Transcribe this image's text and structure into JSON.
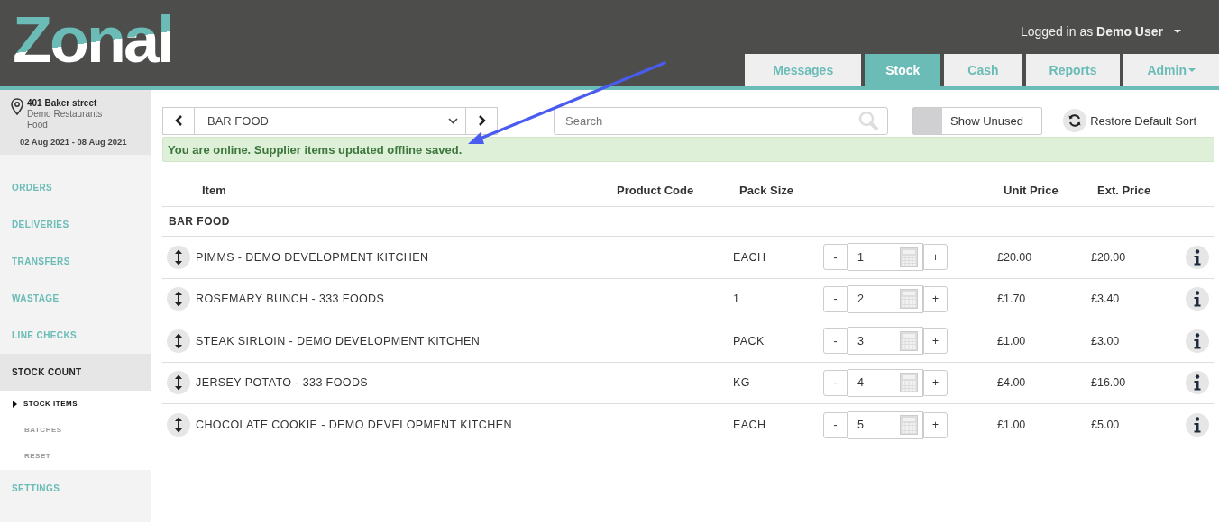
{
  "header": {
    "logo": "Zonal",
    "user_prefix": "Logged in as",
    "user_name": "Demo User"
  },
  "tabs": [
    {
      "label": "Messages",
      "selected": false,
      "dropdown": false
    },
    {
      "label": "Stock",
      "selected": true,
      "dropdown": false
    },
    {
      "label": "Cash",
      "selected": false,
      "dropdown": false
    },
    {
      "label": "Reports",
      "selected": false,
      "dropdown": false
    },
    {
      "label": "Admin",
      "selected": false,
      "dropdown": true
    }
  ],
  "location": {
    "name": "401 Baker street",
    "company": "Demo Restaurants",
    "area": "Food",
    "dates": "02 Aug 2021 - 08 Aug 2021"
  },
  "sidebar": {
    "items": [
      {
        "label": "ORDERS",
        "selected": false
      },
      {
        "label": "DELIVERIES",
        "selected": false
      },
      {
        "label": "TRANSFERS",
        "selected": false
      },
      {
        "label": "WASTAGE",
        "selected": false
      },
      {
        "label": "LINE CHECKS",
        "selected": false
      },
      {
        "label": "STOCK COUNT",
        "selected": true,
        "children": [
          {
            "label": "STOCK ITEMS",
            "selected": true
          },
          {
            "label": "BATCHES",
            "selected": false
          },
          {
            "label": "RESET",
            "selected": false
          }
        ]
      },
      {
        "label": "SETTINGS",
        "selected": false
      }
    ]
  },
  "toolbar": {
    "category": "BAR FOOD",
    "search": {
      "placeholder": "Search"
    },
    "show_unused": {
      "label": "Show Unused",
      "on": false
    },
    "restore": "Restore Default Sort"
  },
  "alert": "You are online. Supplier items updated offline saved.",
  "annotation": {
    "kind": "arrow"
  },
  "table": {
    "columns": [
      "Item",
      "Product Code",
      "Pack Size",
      "Unit Price",
      "Ext. Price"
    ],
    "group": "BAR FOOD",
    "rows": [
      {
        "item": "PIMMS - DEMO DEVELOPMENT KITCHEN",
        "pack_size": "EACH",
        "qty": "1",
        "unit_price": "£20.00",
        "ext_price": "£20.00"
      },
      {
        "item": "ROSEMARY BUNCH - 333 FOODS",
        "pack_size": "1",
        "qty": "2",
        "unit_price": "£1.70",
        "ext_price": "£3.40"
      },
      {
        "item": "STEAK SIRLOIN - DEMO DEVELOPMENT KITCHEN",
        "pack_size": "PACK",
        "qty": "3",
        "unit_price": "£1.00",
        "ext_price": "£3.00"
      },
      {
        "item": "JERSEY POTATO - 333 FOODS",
        "pack_size": "KG",
        "qty": "4",
        "unit_price": "£4.00",
        "ext_price": "£16.00"
      },
      {
        "item": "CHOCOLATE COOKIE - DEMO DEVELOPMENT KITCHEN",
        "pack_size": "EACH",
        "qty": "5",
        "unit_price": "£1.00",
        "ext_price": "£5.00"
      }
    ],
    "stepper": {
      "minus": "-",
      "plus": "+"
    }
  }
}
